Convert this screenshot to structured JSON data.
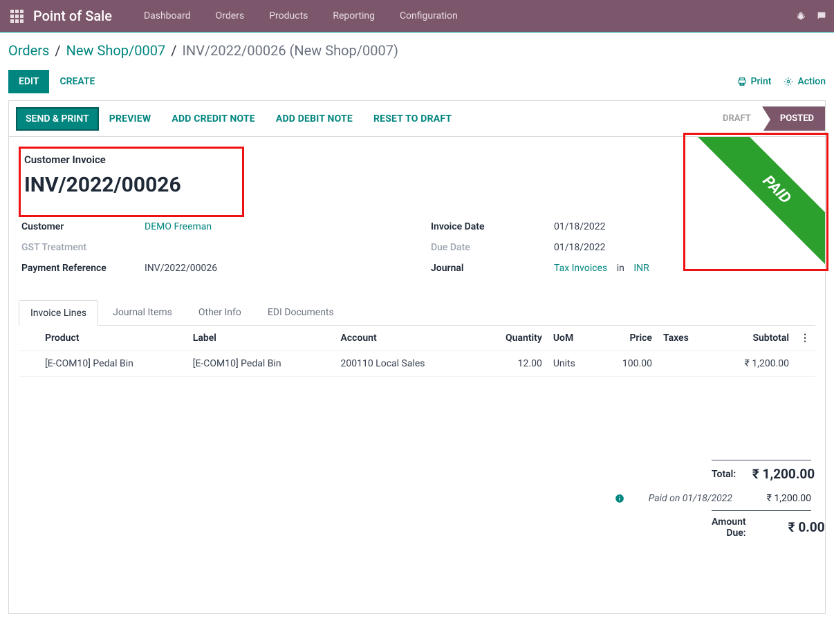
{
  "topbar": {
    "brand": "Point of Sale",
    "nav": [
      "Dashboard",
      "Orders",
      "Products",
      "Reporting",
      "Configuration"
    ]
  },
  "breadcrumb": {
    "orders": "Orders",
    "shop": "New Shop/0007",
    "current": "INV/2022/00026 (New Shop/0007)"
  },
  "head": {
    "edit": "EDIT",
    "create": "CREATE",
    "print": "Print",
    "action": "Action"
  },
  "toolbar": {
    "send_print": "SEND & PRINT",
    "preview": "PREVIEW",
    "add_credit": "ADD CREDIT NOTE",
    "add_debit": "ADD DEBIT NOTE",
    "reset_draft": "RESET TO DRAFT"
  },
  "status": {
    "draft": "DRAFT",
    "posted": "POSTED"
  },
  "ribbon": "PAID",
  "invoice": {
    "subtitle": "Customer Invoice",
    "number": "INV/2022/00026",
    "customer_label": "Customer",
    "customer": "DEMO Freeman",
    "gst_label": "GST Treatment",
    "payref_label": "Payment Reference",
    "payref": "INV/2022/00026",
    "invdate_label": "Invoice Date",
    "invdate": "01/18/2022",
    "duedate_label": "Due Date",
    "duedate": "01/18/2022",
    "journal_label": "Journal",
    "journal": "Tax Invoices",
    "journal_in": "in",
    "journal_cur": "INR"
  },
  "tabs": [
    "Invoice Lines",
    "Journal Items",
    "Other Info",
    "EDI Documents"
  ],
  "table": {
    "cols": {
      "product": "Product",
      "label": "Label",
      "account": "Account",
      "qty": "Quantity",
      "uom": "UoM",
      "price": "Price",
      "taxes": "Taxes",
      "subtotal": "Subtotal"
    },
    "rows": [
      {
        "product": "[E-COM10] Pedal Bin",
        "label": "[E-COM10] Pedal Bin",
        "account": "200110 Local Sales",
        "qty": "12.00",
        "uom": "Units",
        "price": "100.00",
        "taxes": "",
        "subtotal": "₹ 1,200.00"
      }
    ]
  },
  "totals": {
    "total_label": "Total:",
    "total": "₹ 1,200.00",
    "paid_label": "Paid on 01/18/2022",
    "paid": "₹ 1,200.00",
    "due_label": "Amount Due:",
    "due": "₹ 0.00"
  }
}
